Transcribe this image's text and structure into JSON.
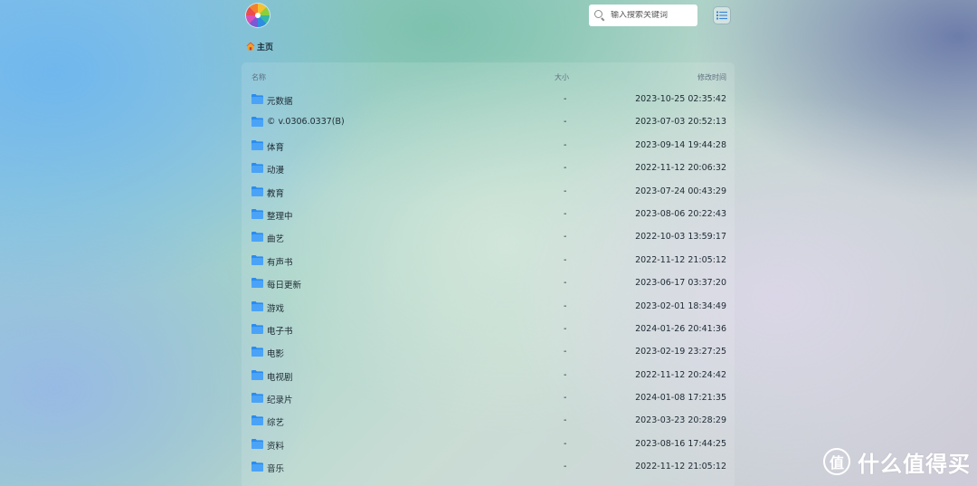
{
  "header": {
    "logo_icon": "multicolor-flower-logo-icon",
    "search": {
      "placeholder": "输入搜索关键词",
      "icon": "search-icon"
    },
    "view_toggle_icon": "list-view-icon"
  },
  "breadcrumb": {
    "home_icon": "home-icon",
    "label": "主页"
  },
  "file_list": {
    "columns": {
      "name": "名称",
      "size": "大小",
      "modified": "修改时间"
    },
    "rows": [
      {
        "name": "元数据",
        "size": "-",
        "modified": "2023-10-25 02:35:42"
      },
      {
        "name": "© v.0306.0337(B)",
        "size": "-",
        "modified": "2023-07-03 20:52:13"
      },
      {
        "name": "体育",
        "size": "-",
        "modified": "2023-09-14 19:44:28"
      },
      {
        "name": "动漫",
        "size": "-",
        "modified": "2022-11-12 20:06:32"
      },
      {
        "name": "教育",
        "size": "-",
        "modified": "2023-07-24 00:43:29"
      },
      {
        "name": "整理中",
        "size": "-",
        "modified": "2023-08-06 20:22:43"
      },
      {
        "name": "曲艺",
        "size": "-",
        "modified": "2022-10-03 13:59:17"
      },
      {
        "name": "有声书",
        "size": "-",
        "modified": "2022-11-12 21:05:12"
      },
      {
        "name": "每日更新",
        "size": "-",
        "modified": "2023-06-17 03:37:20"
      },
      {
        "name": "游戏",
        "size": "-",
        "modified": "2023-02-01 18:34:49"
      },
      {
        "name": "电子书",
        "size": "-",
        "modified": "2024-01-26 20:41:36"
      },
      {
        "name": "电影",
        "size": "-",
        "modified": "2023-02-19 23:27:25"
      },
      {
        "name": "电视剧",
        "size": "-",
        "modified": "2022-11-12 20:24:42"
      },
      {
        "name": "纪录片",
        "size": "-",
        "modified": "2024-01-08 17:21:35"
      },
      {
        "name": "综艺",
        "size": "-",
        "modified": "2023-03-23 20:28:29"
      },
      {
        "name": "资料",
        "size": "-",
        "modified": "2023-08-16 17:44:25"
      },
      {
        "name": "音乐",
        "size": "-",
        "modified": "2022-11-12 21:05:12"
      }
    ]
  },
  "watermark": {
    "logo_glyph": "值",
    "text": "什么值得买"
  },
  "colors": {
    "folder": "#2a8cf0",
    "accent": "#2a8cf0"
  }
}
